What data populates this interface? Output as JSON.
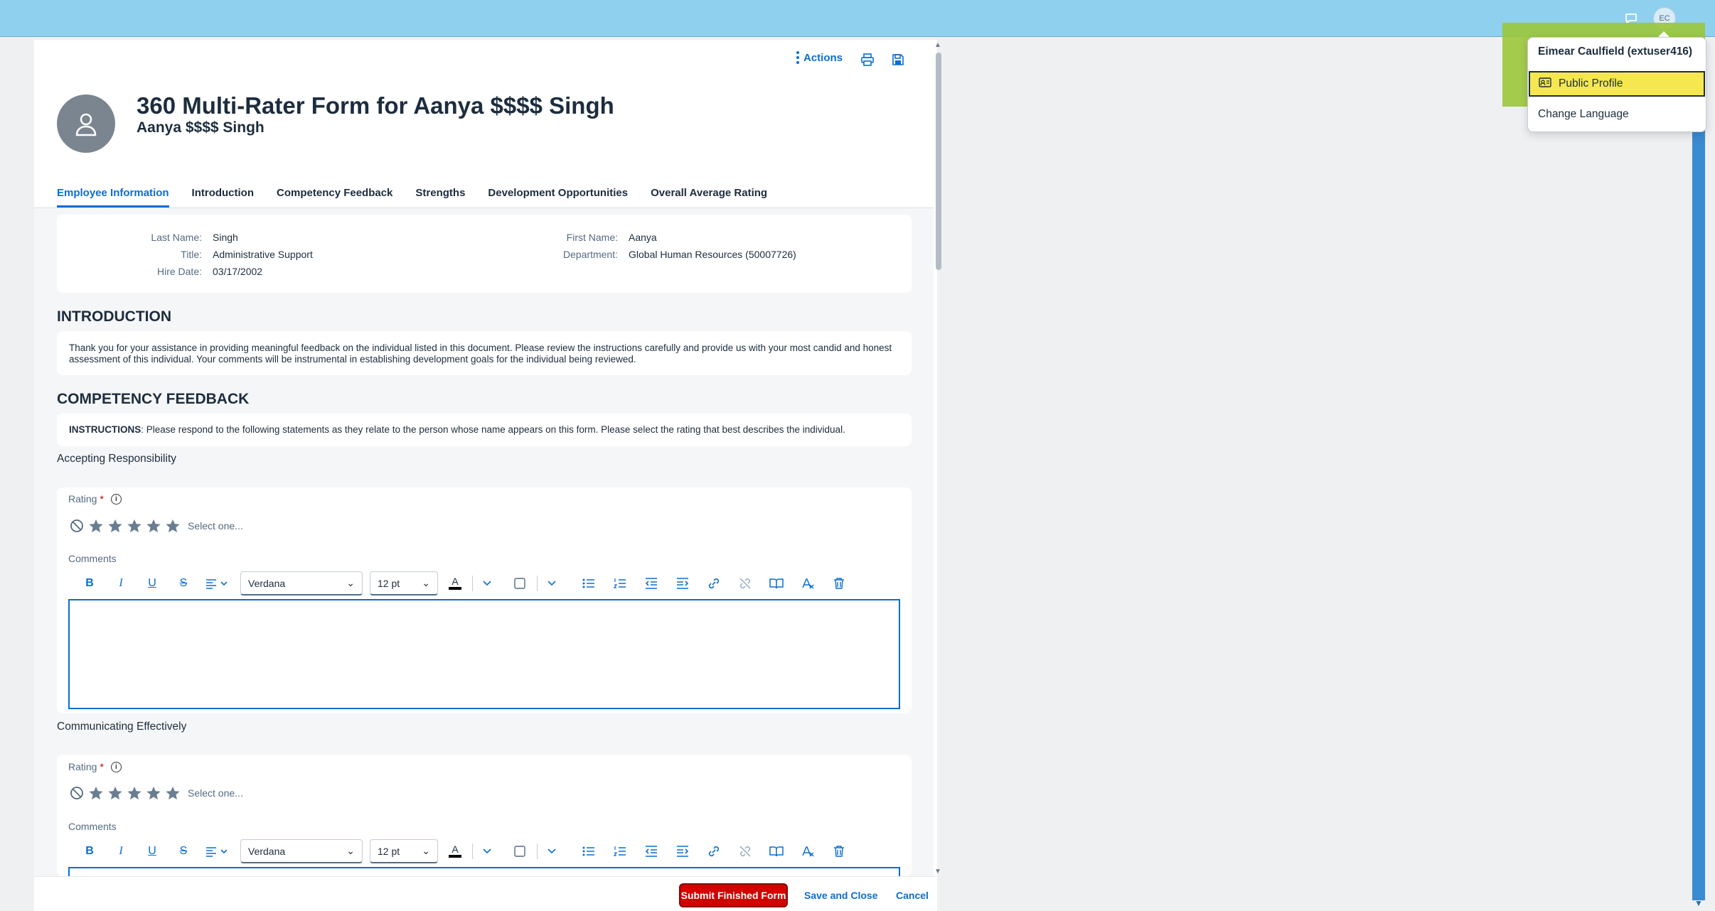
{
  "shell": {
    "avatar_initials": "EC",
    "notifications_icon": "speech-bubble-icon"
  },
  "user_menu": {
    "name": "Eimear Caulfield (extuser416)",
    "items": [
      {
        "label": "Public Profile",
        "icon": "profile-card-icon",
        "highlighted": true
      },
      {
        "label": "Change Language",
        "icon": null,
        "highlighted": false
      }
    ]
  },
  "header": {
    "actions_label": "Actions",
    "title": "360 Multi-Rater Form for Aanya $$$$ Singh",
    "subtitle": "Aanya $$$$ Singh"
  },
  "tabs": [
    {
      "label": "Employee Information",
      "active": true
    },
    {
      "label": "Introduction",
      "active": false
    },
    {
      "label": "Competency Feedback",
      "active": false
    },
    {
      "label": "Strengths",
      "active": false
    },
    {
      "label": "Development Opportunities",
      "active": false
    },
    {
      "label": "Overall Average Rating",
      "active": false
    }
  ],
  "employee": {
    "last_name_label": "Last Name:",
    "last_name": "Singh",
    "title_label": "Title:",
    "title": "Administrative Support",
    "hire_date_label": "Hire Date:",
    "hire_date": "03/17/2002",
    "first_name_label": "First Name:",
    "first_name": "Aanya",
    "department_label": "Department:",
    "department": "Global Human Resources (50007726)"
  },
  "introduction": {
    "heading": "INTRODUCTION",
    "text": "Thank you for your assistance in providing meaningful feedback on the individual listed in this document. Please review the instructions carefully and provide us with your most candid and honest assessment of this individual. Your comments will be instrumental in establishing development goals for the individual being reviewed."
  },
  "competency": {
    "heading": "COMPETENCY FEEDBACK",
    "instructions_label": "INSTRUCTIONS",
    "instructions_text": ": Please respond to the following statements as they relate to the person whose name appears on this form. Please select the rating that best describes the individual.",
    "rating_label": "Rating",
    "required_mark": "*",
    "info_glyph": "i",
    "select_placeholder": "Select one...",
    "comments_label": "Comments",
    "items": [
      {
        "name": "Accepting Responsibility",
        "rating": 0
      },
      {
        "name": "Communicating Effectively",
        "rating": 0
      }
    ]
  },
  "editor_toolbar": {
    "bold": "B",
    "italic": "I",
    "underline": "U",
    "strike": "S",
    "text_color_glyph": "A",
    "font": "Verdana",
    "size": "12 pt"
  },
  "footer": {
    "submit_label": "Submit Finished Form",
    "save_close_label": "Save and Close",
    "cancel_label": "Cancel"
  },
  "colors": {
    "shell": "#8fd0ef",
    "accent": "#0a6ed1",
    "submit": "#d40000",
    "highlight_green": "#9bc73a",
    "highlight_yellow": "#f6e750"
  }
}
